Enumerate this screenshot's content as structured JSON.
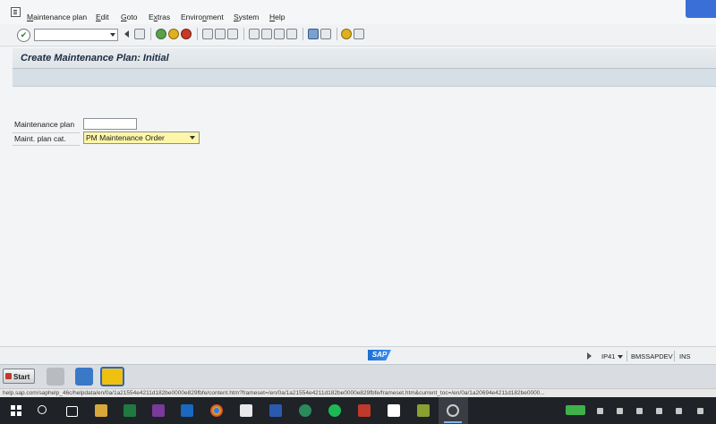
{
  "menu": {
    "items": [
      {
        "label": "Maintenance plan",
        "hotkey": "M"
      },
      {
        "label": "Edit",
        "hotkey": "E"
      },
      {
        "label": "Goto",
        "hotkey": "G"
      },
      {
        "label": "Extras",
        "hotkey": "x"
      },
      {
        "label": "Environment",
        "hotkey": "n"
      },
      {
        "label": "System",
        "hotkey": "S"
      },
      {
        "label": "Help",
        "hotkey": "H"
      }
    ]
  },
  "toolbar": {
    "command_field_value": "",
    "icons": [
      "enter-icon",
      "back-icon",
      "save-icon",
      "back-green-icon",
      "exit-icon",
      "cancel-icon",
      "print-icon",
      "find-icon",
      "find-next-icon",
      "first-page-icon",
      "previous-page-icon",
      "next-page-icon",
      "last-page-icon",
      "new-session-icon",
      "shortcut-icon",
      "help-icon",
      "layout-menu-icon"
    ]
  },
  "page": {
    "title": "Create Maintenance Plan: Initial"
  },
  "form": {
    "maintenance_plan_label": "Maintenance plan",
    "maintenance_plan_value": "",
    "plan_category_label": "Maint. plan cat.",
    "plan_category_value": "PM Maintenance Order"
  },
  "status": {
    "logo_text": "SAP",
    "transaction": "IP41",
    "system": "BMSSAPDEV",
    "mode": "INS"
  },
  "launcher": {
    "start_label": "Start"
  },
  "browser": {
    "status_url": "help.sap.com/saphelp_46c/helpdata/en/0a/1a21554e4211d182be0000e829fbfe/content.htm?frameset=/en/0a/1a21554e4211d182be0000e829fbfe/frameset.htm&current_toc=/en/0a/1a20694e4211d182be0000..."
  },
  "colors": {
    "title_text": "#1a2a40",
    "required_field": "#fdf6a8",
    "taskbar": "#1f2227",
    "sap_blue": "#1e6fd0"
  }
}
